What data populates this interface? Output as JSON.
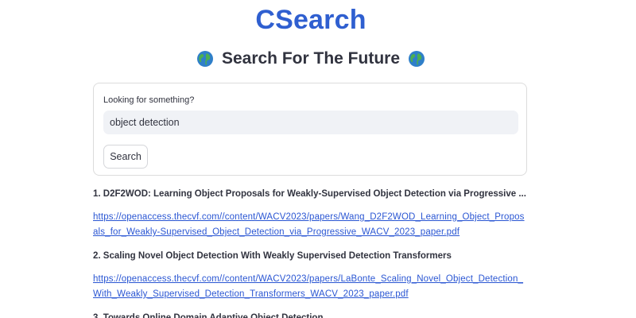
{
  "header": {
    "app_title": "CSearch",
    "subtitle": "Search For The Future"
  },
  "search": {
    "label": "Looking for something?",
    "value": "object detection",
    "button_label": "Search"
  },
  "results": [
    {
      "title": "1. D2F2WOD: Learning Object Proposals for Weakly-Supervised Object Detection via Progressive ...",
      "link": "https://openaccess.thecvf.com//content/WACV2023/papers/Wang_D2F2WOD_Learning_Object_Proposals_for_Weakly-Supervised_Object_Detection_via_Progressive_WACV_2023_paper.pdf"
    },
    {
      "title": "2. Scaling Novel Object Detection With Weakly Supervised Detection Transformers",
      "link": "https://openaccess.thecvf.com//content/WACV2023/papers/LaBonte_Scaling_Novel_Object_Detection_With_Weakly_Supervised_Detection_Transformers_WACV_2023_paper.pdf"
    },
    {
      "title": "3. Towards Online Domain Adaptive Object Detection"
    }
  ],
  "icons": {
    "globe_left": "globe-icon",
    "globe_right": "globe-icon"
  },
  "colors": {
    "brand": "#2f5fd0",
    "link": "#2a56d3",
    "input_bg": "#f0f2f6"
  }
}
